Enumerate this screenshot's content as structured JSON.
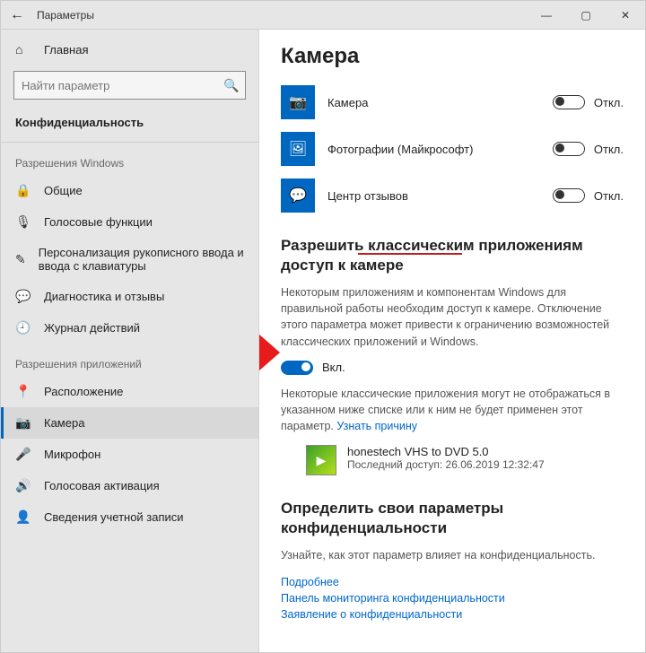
{
  "titlebar": {
    "title": "Параметры"
  },
  "sidebar": {
    "home": "Главная",
    "search_placeholder": "Найти параметр",
    "category": "Конфиденциальность",
    "group_windows": "Разрешения Windows",
    "group_apps": "Разрешения приложений",
    "nav_windows": [
      {
        "icon": "🔒",
        "label": "Общие"
      },
      {
        "icon": "🎙",
        "label": "Голосовые функции"
      },
      {
        "icon": "✎",
        "label": "Персонализация рукописного ввода и ввода с клавиатуры"
      },
      {
        "icon": "💬",
        "label": "Диагностика и отзывы"
      },
      {
        "icon": "🕘",
        "label": "Журнал действий"
      }
    ],
    "nav_apps": [
      {
        "icon": "📍",
        "label": "Расположение",
        "active": false
      },
      {
        "icon": "📷",
        "label": "Камера",
        "active": true
      },
      {
        "icon": "🎤",
        "label": "Микрофон",
        "active": false
      },
      {
        "icon": "🔊",
        "label": "Голосовая активация",
        "active": false
      },
      {
        "icon": "👤",
        "label": "Сведения учетной записи",
        "active": false
      }
    ]
  },
  "content": {
    "heading": "Камера",
    "apps": [
      {
        "icon": "📷",
        "name": "Камера",
        "state": "Откл."
      },
      {
        "icon": "🖼",
        "name": "Фотографии (Майкрософт)",
        "state": "Откл."
      },
      {
        "icon": "💬",
        "name": "Центр отзывов",
        "state": "Откл."
      }
    ],
    "classic_title": "Разрешить классическим приложениям доступ к камере",
    "classic_desc": "Некоторым приложениям и компонентам Windows для правильной работы необходим доступ к камере. Отключение этого параметра может привести к ограничению возможностей классических приложений и Windows.",
    "classic_toggle_label": "Вкл.",
    "classic_note_prefix": "Некоторые классические приложения могут не отображаться в указанном ниже списке или к ним не будет применен этот параметр. ",
    "classic_note_link": "Узнать причину",
    "legacy_app": {
      "name": "honestech VHS to DVD 5.0",
      "last_access": "Последний доступ: 26.06.2019 12:32:47"
    },
    "privacy_title": "Определить свои параметры конфиденциальности",
    "privacy_desc": "Узнайте, как этот параметр влияет на конфиденциальность.",
    "links": [
      "Подробнее",
      "Панель мониторинга конфиденциальности",
      "Заявление о конфиденциальности"
    ]
  }
}
